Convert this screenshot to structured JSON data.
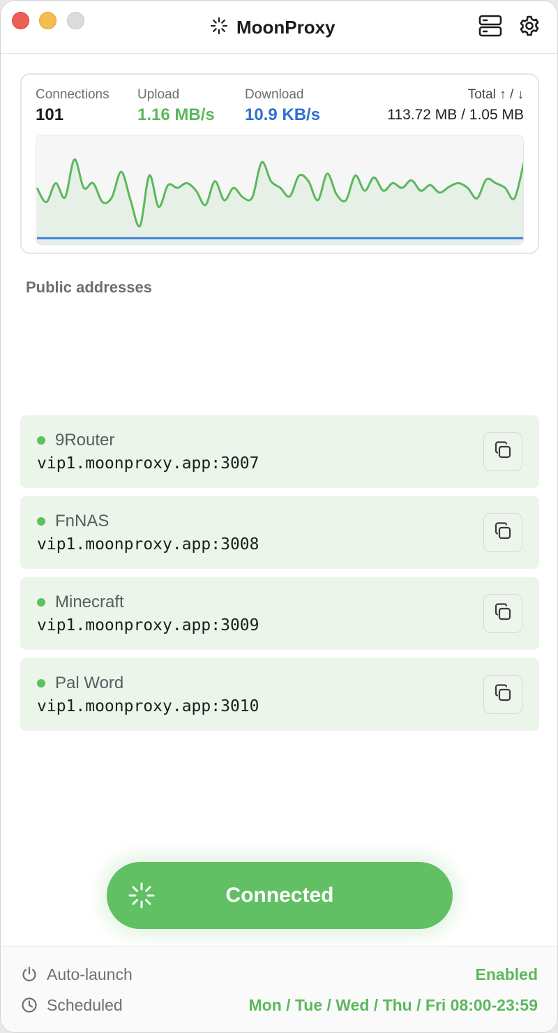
{
  "window": {
    "title": "MoonProxy",
    "icons": {
      "logo": "sparkle-icon",
      "servers": "server-stack-icon",
      "settings": "gear-icon"
    }
  },
  "stats": {
    "connections_label": "Connections",
    "connections_value": "101",
    "upload_label": "Upload",
    "upload_value": "1.16 MB/s",
    "download_label": "Download",
    "download_value": "10.9 KB/s",
    "total_label": "Total ↑ / ↓",
    "total_value": "113.72 MB / 1.05 MB",
    "colors": {
      "upload": "#5cb85c",
      "download": "#2f6fd6"
    }
  },
  "chart_data": {
    "type": "line",
    "title": "",
    "xlabel": "",
    "ylabel": "",
    "ylim": [
      0,
      1
    ],
    "series": [
      {
        "values": [
          0.55,
          0.4,
          0.6,
          0.45,
          0.85,
          0.55,
          0.6,
          0.4,
          0.45,
          0.72,
          0.42,
          0.15,
          0.68,
          0.35,
          0.58,
          0.55,
          0.6,
          0.52,
          0.37,
          0.62,
          0.42,
          0.55,
          0.45,
          0.45,
          0.82,
          0.62,
          0.55,
          0.46,
          0.68,
          0.62,
          0.42,
          0.7,
          0.48,
          0.42,
          0.68,
          0.52,
          0.66,
          0.52,
          0.6,
          0.55,
          0.63,
          0.52,
          0.58,
          0.5,
          0.56,
          0.6,
          0.55,
          0.44,
          0.64,
          0.6,
          0.55,
          0.44,
          0.82
        ]
      },
      {
        "values": [
          0.02,
          0.02,
          0.02,
          0.02,
          0.02,
          0.02,
          0.02,
          0.02,
          0.02,
          0.02,
          0.02,
          0.02,
          0.02,
          0.02,
          0.02,
          0.02,
          0.02,
          0.02,
          0.02,
          0.02,
          0.02,
          0.02,
          0.02,
          0.02,
          0.02,
          0.02,
          0.02,
          0.02,
          0.02,
          0.02,
          0.02,
          0.02,
          0.02,
          0.02,
          0.02,
          0.02,
          0.02,
          0.02,
          0.02,
          0.02,
          0.02,
          0.02,
          0.02,
          0.02,
          0.02,
          0.02,
          0.02,
          0.02,
          0.02,
          0.02,
          0.02,
          0.02,
          0.02
        ]
      }
    ],
    "colors": [
      "#5cb85c",
      "#3b82d6"
    ],
    "grid": false
  },
  "public_addresses": {
    "title": "Public addresses",
    "items": [
      {
        "name": "9Router",
        "host": "vip1.moonproxy.app:3007",
        "status_color": "#5cc160"
      },
      {
        "name": "FnNAS",
        "host": "vip1.moonproxy.app:3008",
        "status_color": "#5cc160"
      },
      {
        "name": "Minecraft",
        "host": "vip1.moonproxy.app:3009",
        "status_color": "#5cc160"
      },
      {
        "name": "Pal Word",
        "host": "vip1.moonproxy.app:3010",
        "status_color": "#5cc160"
      }
    ],
    "copy_icon": "copy-icon"
  },
  "connect_button": {
    "label": "Connected",
    "icon": "sparkle-icon",
    "color": "#60c063"
  },
  "footer": {
    "auto_launch_label": "Auto-launch",
    "auto_launch_value": "Enabled",
    "scheduled_label": "Scheduled",
    "scheduled_value": "Mon / Tue / Wed / Thu / Fri 08:00-23:59",
    "icons": {
      "auto_launch": "power-icon",
      "scheduled": "clock-icon"
    }
  }
}
